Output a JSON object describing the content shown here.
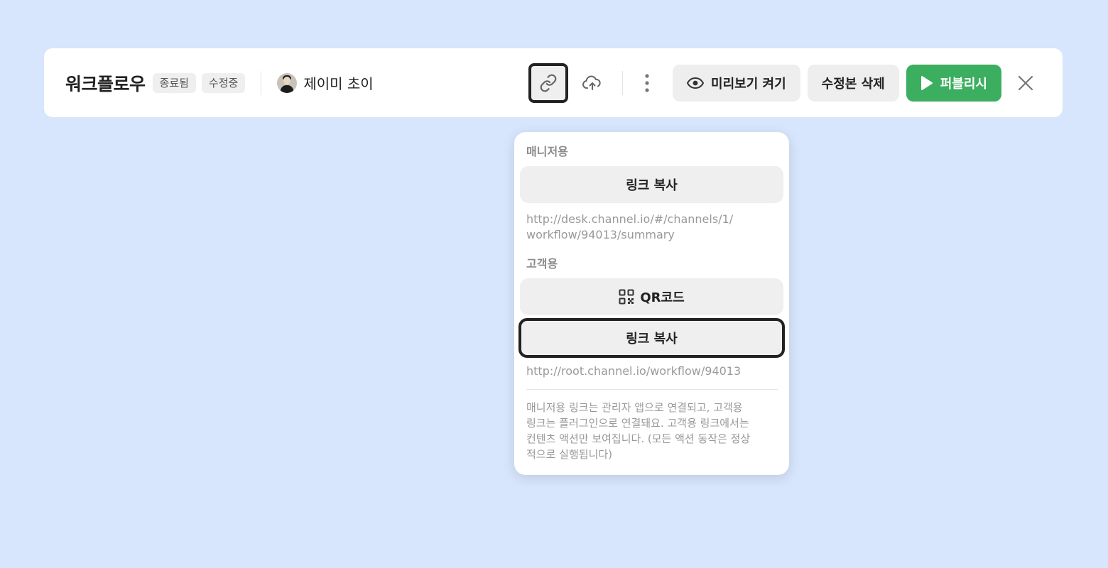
{
  "header": {
    "title": "워크플로우",
    "badges": [
      "종료됨",
      "수정중"
    ],
    "user_name": "제이미 초이",
    "preview_label": "미리보기 켜기",
    "delete_label": "수정본 삭제",
    "publish_label": "퍼블리시"
  },
  "popover": {
    "manager_section": "매니저용",
    "manager_copy_label": "링크 복사",
    "manager_url_line1": "http://desk.channel.io/#/channels/1/",
    "manager_url_line2": "workflow/94013/summary",
    "customer_section": "고객용",
    "qr_label": "QR코드",
    "customer_copy_label": "링크 복사",
    "customer_url": "http://root.channel.io/workflow/94013",
    "note_lines": [
      "매니저용 링크는 관리자 앱으로 연결되고, 고객용",
      "링크는 플러그인으로 연결돼요. 고객용 링크에서는",
      "컨텐츠 액션만 보여집니다. (모든 액션 동작은 정상",
      "적으로 실행됩니다)"
    ]
  },
  "colors": {
    "background": "#d7e5fd",
    "publish_green": "#3cae5f",
    "selected_border": "#222222"
  }
}
